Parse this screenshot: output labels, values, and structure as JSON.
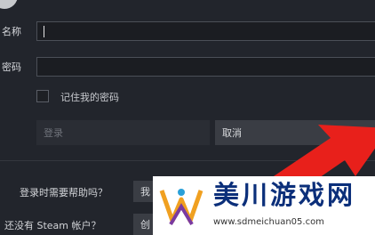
{
  "form": {
    "username_label": "名称",
    "password_label": "密码",
    "remember_label": "记住我的密码",
    "username_value": "",
    "password_value": ""
  },
  "buttons": {
    "login_label": "登录",
    "cancel_label": "取消",
    "help_button_label": "我",
    "create_button_label": "创"
  },
  "footer": {
    "help_text": "登录时需要帮助吗？",
    "signup_text": "还没有 Steam 帐户？"
  },
  "watermark": {
    "title": "美川游戏网",
    "url": "www.sdmeichuan05.com"
  },
  "colors": {
    "background": "#22252c",
    "arrow": "#e8201b",
    "watermark_text": "#0b2f7a"
  },
  "icons": {
    "logo": "steam-logo-icon",
    "arrow": "red-arrow-icon",
    "watermark_logo": "meichuan-logo-icon"
  }
}
